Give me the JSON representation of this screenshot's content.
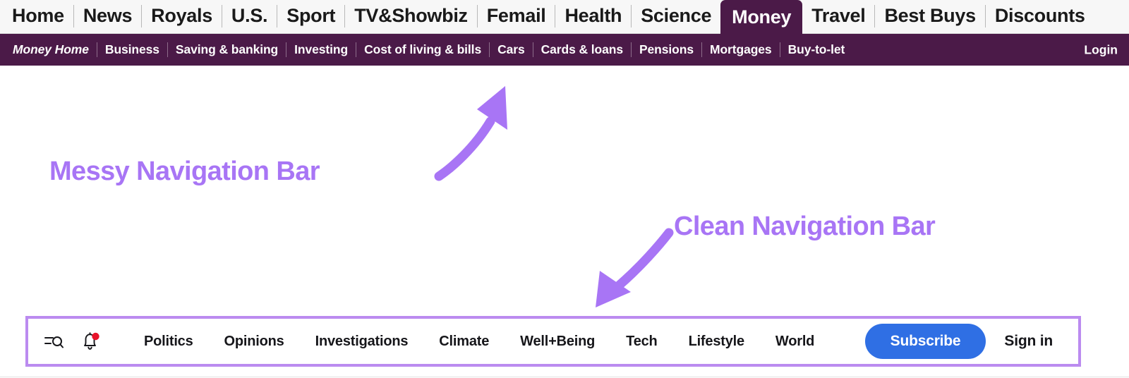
{
  "colors": {
    "annotation_purple": "#a875f5",
    "box_border_purple": "#bb8bf0",
    "messy_bar_purple": "#4b1a48",
    "subscribe_blue": "#2f6fe4",
    "notification_red": "#e8142b"
  },
  "messy_nav": {
    "top_items": [
      {
        "label": "Home",
        "active": false
      },
      {
        "label": "News",
        "active": false
      },
      {
        "label": "Royals",
        "active": false
      },
      {
        "label": "U.S.",
        "active": false
      },
      {
        "label": "Sport",
        "active": false
      },
      {
        "label": "TV&Showbiz",
        "active": false
      },
      {
        "label": "Femail",
        "active": false
      },
      {
        "label": "Health",
        "active": false
      },
      {
        "label": "Science",
        "active": false
      },
      {
        "label": "Money",
        "active": true
      },
      {
        "label": "Travel",
        "active": false
      },
      {
        "label": "Best Buys",
        "active": false
      },
      {
        "label": "Discounts",
        "active": false
      }
    ],
    "sub_items": [
      "Money Home",
      "Business",
      "Saving & banking",
      "Investing",
      "Cost of living & bills",
      "Cars",
      "Cards & loans",
      "Pensions",
      "Mortgages",
      "Buy-to-let"
    ],
    "login_label": "Login"
  },
  "annotations": {
    "messy_label": "Messy Navigation Bar",
    "clean_label": "Clean Navigation Bar",
    "messy_arrow_icon": "curved-arrow-up-right-icon",
    "clean_arrow_icon": "curved-arrow-down-left-icon"
  },
  "clean_nav": {
    "icons": [
      {
        "name": "search-menu-icon"
      },
      {
        "name": "notification-bell-icon",
        "has_badge": true
      }
    ],
    "links": [
      "Politics",
      "Opinions",
      "Investigations",
      "Climate",
      "Well+Being",
      "Tech",
      "Lifestyle",
      "World"
    ],
    "subscribe_label": "Subscribe",
    "signin_label": "Sign in"
  }
}
